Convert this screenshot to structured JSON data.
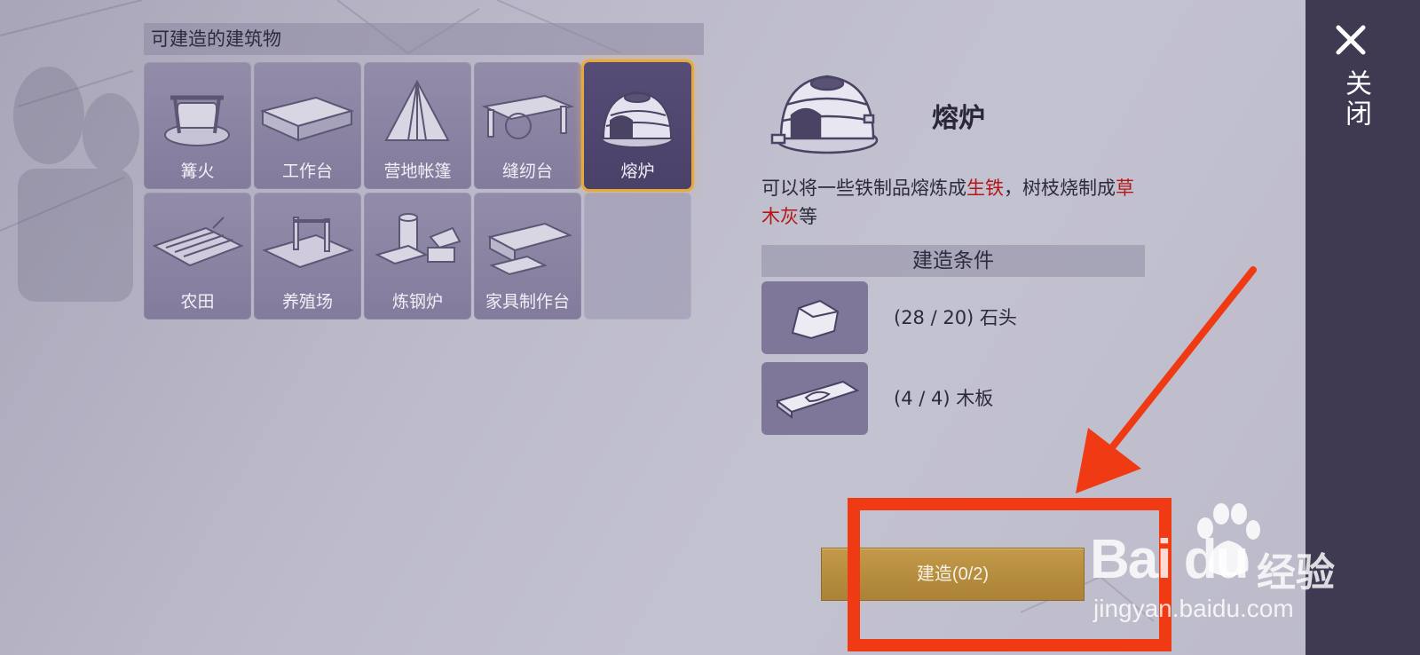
{
  "section_title": "可建造的建筑物",
  "buildings": [
    {
      "label": "篝火",
      "icon": "campfire-icon",
      "selected": false
    },
    {
      "label": "工作台",
      "icon": "workbench-icon",
      "selected": false
    },
    {
      "label": "营地帐篷",
      "icon": "tent-icon",
      "selected": false
    },
    {
      "label": "缝纫台",
      "icon": "sewing-table-icon",
      "selected": false
    },
    {
      "label": "熔炉",
      "icon": "furnace-icon",
      "selected": true
    },
    {
      "label": "农田",
      "icon": "farmland-icon",
      "selected": false
    },
    {
      "label": "养殖场",
      "icon": "farm-pen-icon",
      "selected": false
    },
    {
      "label": "炼钢炉",
      "icon": "steel-furnace-icon",
      "selected": false
    },
    {
      "label": "家具制作台",
      "icon": "furniture-bench-icon",
      "selected": false
    }
  ],
  "detail": {
    "title": "熔炉",
    "icon": "furnace-icon",
    "desc_part1": "可以将一些铁制品熔炼成",
    "desc_hl1": "生铁",
    "desc_part2": "，树枝烧制成",
    "desc_hl2": "草木灰",
    "desc_part3": "等",
    "highlight_color": "#b31717"
  },
  "conditions_header": "建造条件",
  "materials": [
    {
      "text": "(28 / 20) 石头",
      "icon": "stone-icon"
    },
    {
      "text": "(4 / 4) 木板",
      "icon": "plank-icon"
    }
  ],
  "build_button": "建造(0/2)",
  "close_label": "关闭",
  "watermark": {
    "brand": "Bai du",
    "cn": "经验",
    "url": "jingyan.baidu.com"
  },
  "colors": {
    "accent_gold": "#e7a93b",
    "button": "#b88d3f",
    "annotation_red": "#f03a14",
    "side_panel": "#3f3a52"
  }
}
